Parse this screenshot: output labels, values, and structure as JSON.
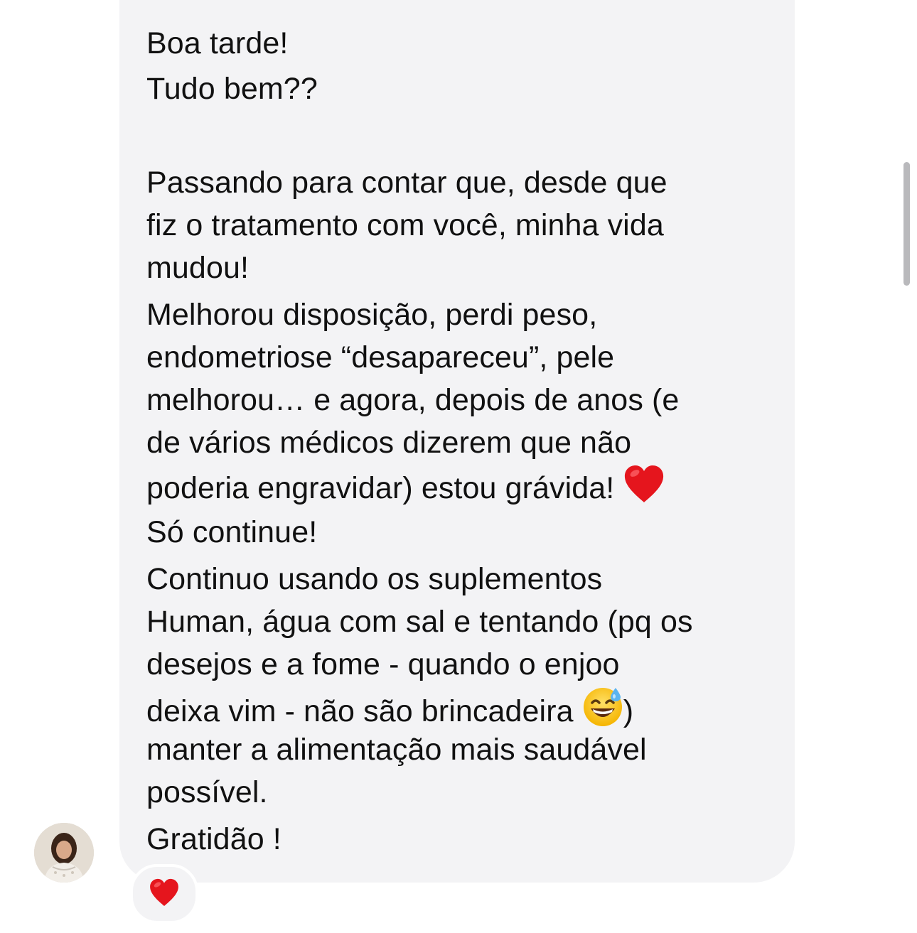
{
  "message": {
    "lines": [
      "Boa tarde!",
      "Tudo bem??",
      "Passando para contar que, desde que",
      "fiz o tratamento com você, minha vida",
      "mudou!",
      "Melhorou disposição, perdi peso,",
      "endometriose “desapareceu”, pele",
      "melhorou… e agora, depois de anos (e",
      "de vários médicos dizerem que não",
      "poderia engravidar) estou grávida!",
      "Só continue!",
      "Continuo usando os suplementos",
      "Human, água com sal e tentando (pq os",
      "desejos e a fome - quando o enjoo",
      "deixa vim - não são brincadeira",
      ")",
      "manter a alimentação mais saudável",
      "possível.",
      "Gratidão !"
    ],
    "inline_emojis": [
      "red-heart",
      "grinning-face-with-sweat"
    ]
  },
  "reaction": {
    "emoji": "red-heart"
  },
  "sender": {
    "avatar": "profile-photo"
  },
  "colors": {
    "bubble_bg": "#f3f3f5",
    "text": "#111111",
    "heart": "#e5151d"
  }
}
